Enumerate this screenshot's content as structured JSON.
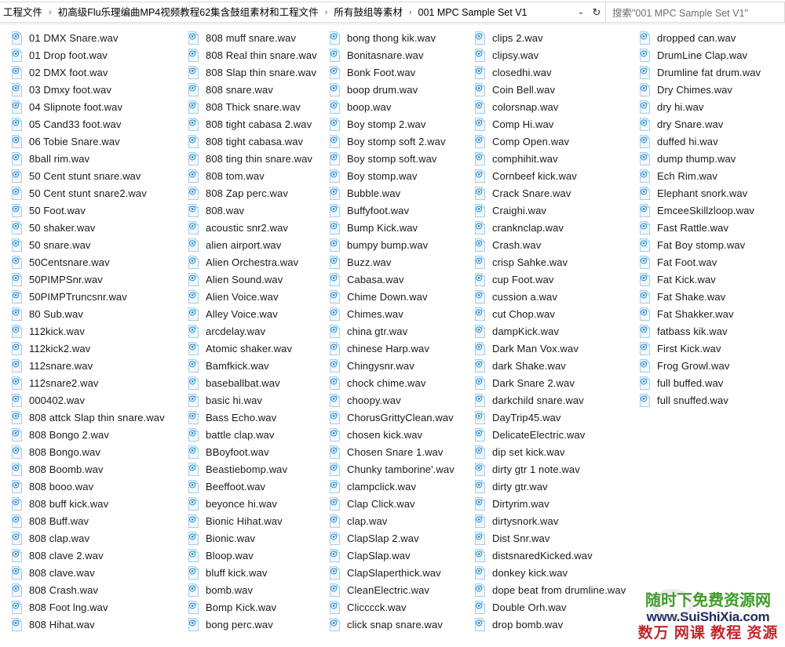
{
  "window": {
    "app": "file-explorer"
  },
  "addressbar": {
    "breadcrumbs": [
      "工程文件",
      "初高级Flu乐理编曲MP4视频教程62集含鼓组素材和工程文件",
      "所有鼓组等素材",
      "001 MPC Sample Set V1"
    ],
    "separator": "›",
    "dropdown_glyph": "⌄",
    "refresh_glyph": "↻",
    "search_placeholder": "搜索\"001 MPC Sample Set V1\""
  },
  "files": {
    "icon_name": "wav-audio-file-icon",
    "items": [
      "01 DMX Snare.wav",
      "01 Drop foot.wav",
      "02 DMX foot.wav",
      "03 Dmxy foot.wav",
      "04 Slipnote foot.wav",
      "05 Cand33 foot.wav",
      "06 Tobie Snare.wav",
      "8ball rim.wav",
      "50 Cent stunt snare.wav",
      "50 Cent stunt snare2.wav",
      "50 Foot.wav",
      "50 shaker.wav",
      "50 snare.wav",
      "50Centsnare.wav",
      "50PIMPSnr.wav",
      "50PIMPTruncsnr.wav",
      "80 Sub.wav",
      "112kick.wav",
      "112kick2.wav",
      "112snare.wav",
      "112snare2.wav",
      "000402.wav",
      "808 attck Slap thin snare.wav",
      "808 Bongo 2.wav",
      "808 Bongo.wav",
      "808 Boomb.wav",
      "808 booo.wav",
      "808 buff kick.wav",
      "808 Buff.wav",
      "808 clap.wav",
      "808 clave 2.wav",
      "808 clave.wav",
      "808 Crash.wav",
      "808 Foot lng.wav",
      "808 Hihat.wav",
      "808 muff snare.wav",
      "808 Real thin snare.wav",
      "808 Slap thin snare.wav",
      "808 snare.wav",
      "808 Thick snare.wav",
      "808 tight cabasa 2.wav",
      "808 tight cabasa.wav",
      "808 ting thin snare.wav",
      "808 tom.wav",
      "808 Zap perc.wav",
      "808.wav",
      "acoustic snr2.wav",
      "alien airport.wav",
      "Alien Orchestra.wav",
      "Alien Sound.wav",
      "Alien Voice.wav",
      "Alley Voice.wav",
      "arcdelay.wav",
      "Atomic shaker.wav",
      "Bamfkick.wav",
      "baseballbat.wav",
      "basic hi.wav",
      "Bass Echo.wav",
      "battle clap.wav",
      "BBoyfoot.wav",
      "Beastiebomp.wav",
      "Beeffoot.wav",
      "beyonce hi.wav",
      "Bionic Hihat.wav",
      "Bionic.wav",
      "Bloop.wav",
      "bluff kick.wav",
      "bomb.wav",
      "Bomp Kick.wav",
      "bong perc.wav",
      "bong thong kik.wav",
      "Bonitasnare.wav",
      "Bonk Foot.wav",
      "boop drum.wav",
      "boop.wav",
      "Boy stomp 2.wav",
      "Boy stomp soft 2.wav",
      "Boy stomp soft.wav",
      "Boy stomp.wav",
      "Bubble.wav",
      "Buffyfoot.wav",
      "Bump Kick.wav",
      "bumpy bump.wav",
      "Buzz.wav",
      "Cabasa.wav",
      "Chime Down.wav",
      "Chimes.wav",
      "china gtr.wav",
      "chinese Harp.wav",
      "Chingysnr.wav",
      "chock chime.wav",
      "choopy.wav",
      "ChorusGrittyClean.wav",
      "chosen kick.wav",
      "Chosen Snare 1.wav",
      "Chunky tamborine'.wav",
      "clampclick.wav",
      "Clap Click.wav",
      "clap.wav",
      "ClapSlap 2.wav",
      "ClapSlap.wav",
      "ClapSlaperthick.wav",
      "CleanElectric.wav",
      "Clicccck.wav",
      "click snap snare.wav",
      "clips 2.wav",
      "clipsy.wav",
      "closedhi.wav",
      "Coin Bell.wav",
      "colorsnap.wav",
      "Comp Hi.wav",
      "Comp Open.wav",
      "comphihit.wav",
      "Cornbeef kick.wav",
      "Crack Snare.wav",
      "Craighi.wav",
      "cranknclap.wav",
      "Crash.wav",
      "crisp Sahke.wav",
      "cup Foot.wav",
      "cussion a.wav",
      "cut Chop.wav",
      "dampKick.wav",
      "Dark Man Vox.wav",
      "dark Shake.wav",
      "Dark Snare 2.wav",
      "darkchild snare.wav",
      "DayTrip45.wav",
      "DelicateElectric.wav",
      "dip set kick.wav",
      "dirty gtr 1 note.wav",
      "dirty gtr.wav",
      "Dirtyrim.wav",
      "dirtysnork.wav",
      "Dist Snr.wav",
      "distsnaredKicked.wav",
      "donkey kick.wav",
      "dope beat from drumline.wav",
      "Double Orh.wav",
      "drop bomb.wav",
      "dropped can.wav",
      "DrumLine Clap.wav",
      "Drumline fat drum.wav",
      "Dry Chimes.wav",
      "dry hi.wav",
      "dry Snare.wav",
      "duffed hi.wav",
      "dump thump.wav",
      "Ech Rim.wav",
      "Elephant snork.wav",
      "EmceeSkillzloop.wav",
      "Fast Rattle.wav",
      "Fat Boy stomp.wav",
      "Fat Foot.wav",
      "Fat Kick.wav",
      "Fat Shake.wav",
      "Fat Shakker.wav",
      "fatbass kik.wav",
      "First Kick.wav",
      "Frog Growl.wav",
      "full buffed.wav",
      "full snuffed.wav"
    ],
    "column_breaks": [
      35,
      70,
      105,
      140,
      161
    ]
  },
  "watermark": {
    "line1": "随时下免费资源网",
    "line2": "www.SuiShiXia.com",
    "line3": "数万 网课 教程 资源",
    "color1": "#3f9b27",
    "color2": "#1d2a63",
    "color3": "#c0272d"
  }
}
